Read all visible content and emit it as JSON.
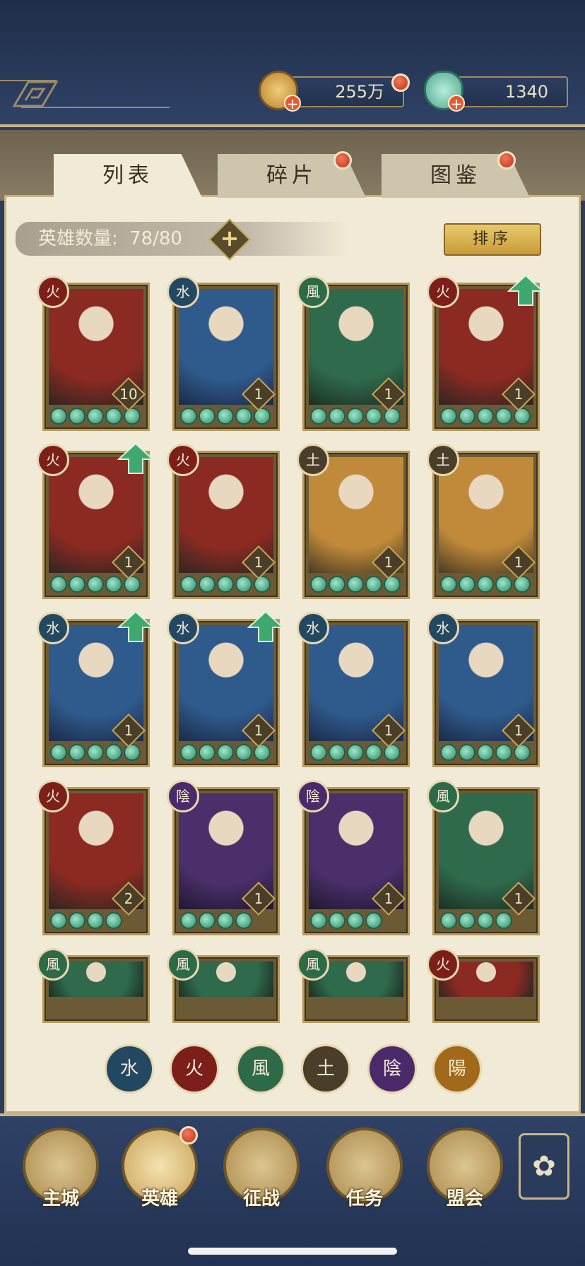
{
  "header": {
    "gold_amount": "255万",
    "gem_amount": "1340",
    "gold_icon": "coin-icon",
    "gem_icon": "jade-shell-icon"
  },
  "tabs": [
    {
      "label": "列表",
      "active": true
    },
    {
      "label": "碎片",
      "active": false
    },
    {
      "label": "图鉴",
      "active": false
    }
  ],
  "hero_count": {
    "label": "英雄数量:",
    "value": "78/80"
  },
  "add_label": "+",
  "sort_label": "排序",
  "elements": {
    "fire": "火",
    "water": "水",
    "wind": "風",
    "earth": "土",
    "yin": "陰",
    "yang": "陽"
  },
  "cards": [
    {
      "element": "火",
      "level": "10",
      "stars": 5,
      "upgrade": false
    },
    {
      "element": "水",
      "level": "1",
      "stars": 5,
      "upgrade": false
    },
    {
      "element": "風",
      "level": "1",
      "stars": 5,
      "upgrade": false
    },
    {
      "element": "火",
      "level": "1",
      "stars": 5,
      "upgrade": true
    },
    {
      "element": "火",
      "level": "1",
      "stars": 5,
      "upgrade": true
    },
    {
      "element": "火",
      "level": "1",
      "stars": 5,
      "upgrade": false
    },
    {
      "element": "土",
      "level": "1",
      "stars": 5,
      "upgrade": false
    },
    {
      "element": "土",
      "level": "1",
      "stars": 5,
      "upgrade": false
    },
    {
      "element": "水",
      "level": "1",
      "stars": 5,
      "upgrade": true
    },
    {
      "element": "水",
      "level": "1",
      "stars": 5,
      "upgrade": true
    },
    {
      "element": "水",
      "level": "1",
      "stars": 5,
      "upgrade": false
    },
    {
      "element": "水",
      "level": "1",
      "stars": 5,
      "upgrade": false
    },
    {
      "element": "火",
      "level": "2",
      "stars": 4,
      "upgrade": false
    },
    {
      "element": "陰",
      "level": "1",
      "stars": 4,
      "upgrade": false
    },
    {
      "element": "陰",
      "level": "1",
      "stars": 4,
      "upgrade": false
    },
    {
      "element": "風",
      "level": "1",
      "stars": 4,
      "upgrade": false
    },
    {
      "element": "風",
      "level": "",
      "stars": 0,
      "upgrade": false
    },
    {
      "element": "風",
      "level": "",
      "stars": 0,
      "upgrade": false
    },
    {
      "element": "風",
      "level": "",
      "stars": 0,
      "upgrade": false
    },
    {
      "element": "火",
      "level": "",
      "stars": 0,
      "upgrade": false
    }
  ],
  "filters": [
    "水",
    "火",
    "風",
    "土",
    "陰",
    "陽"
  ],
  "nav": [
    {
      "label": "主城",
      "icon": "palace-icon"
    },
    {
      "label": "英雄",
      "icon": "hero-portrait-icon"
    },
    {
      "label": "征战",
      "icon": "battle-horn-icon"
    },
    {
      "label": "任务",
      "icon": "scroll-bell-icon"
    },
    {
      "label": "盟会",
      "icon": "gate-icon"
    }
  ],
  "nav_menu_icon": "flower-menu-icon",
  "colors": {
    "fire": "#7c1f1a",
    "water": "#234862",
    "wind": "#2d6a47",
    "earth": "#4a3e2a",
    "yin": "#4b2a6a",
    "yang": "#a06a1a",
    "panel": "#f1ead7",
    "header": "#2b3c5c"
  }
}
